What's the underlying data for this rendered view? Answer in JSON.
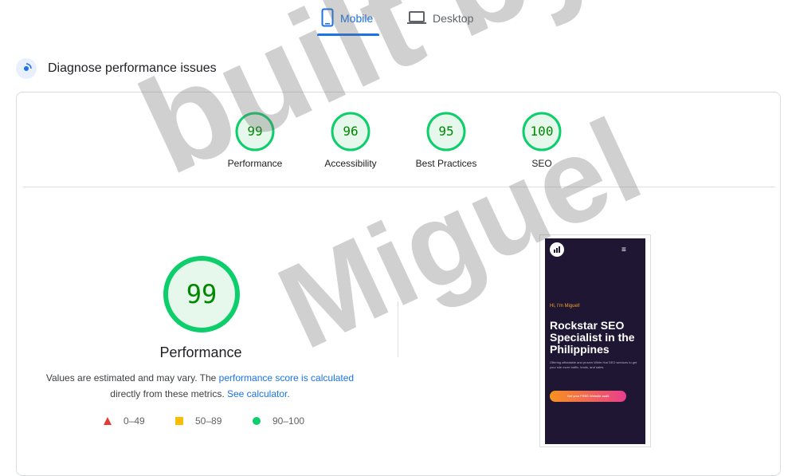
{
  "tabs": {
    "mobile_label": "Mobile",
    "desktop_label": "Desktop",
    "active": "Mobile"
  },
  "section": {
    "title": "Diagnose performance issues"
  },
  "scores": [
    {
      "label": "Performance",
      "value": 99
    },
    {
      "label": "Accessibility",
      "value": 96
    },
    {
      "label": "Best Practices",
      "value": 95
    },
    {
      "label": "SEO",
      "value": 100
    }
  ],
  "main_score": {
    "value": 99,
    "label": "Performance"
  },
  "note": {
    "text1": "Values are estimated and may vary. The ",
    "link1": "performance score is calculated",
    "text2": " directly from these metrics. ",
    "link2": "See calculator."
  },
  "legend": [
    {
      "range": "0–49",
      "shape": "triangle",
      "color": "#e53935"
    },
    {
      "range": "50–89",
      "shape": "square",
      "color": "#fbbc04"
    },
    {
      "range": "90–100",
      "shape": "circle",
      "color": "#0cce6b"
    }
  ],
  "colors": {
    "pass_stroke": "#0cce6b",
    "pass_fill": "#e6f7ec",
    "pass_text": "#008800",
    "accent": "#1a73e8"
  },
  "screenshot": {
    "greeting": "Hi, I'm Miguel!",
    "headline": "Rockstar SEO Specialist in the Philippines",
    "subtext": "Offering affordable and proven White Hat SEO services to get your site more traffic, leads, and sales.",
    "cta": "Get your FREE Website audit"
  },
  "watermark": {
    "line1": "built by",
    "line2": "Miguel"
  }
}
